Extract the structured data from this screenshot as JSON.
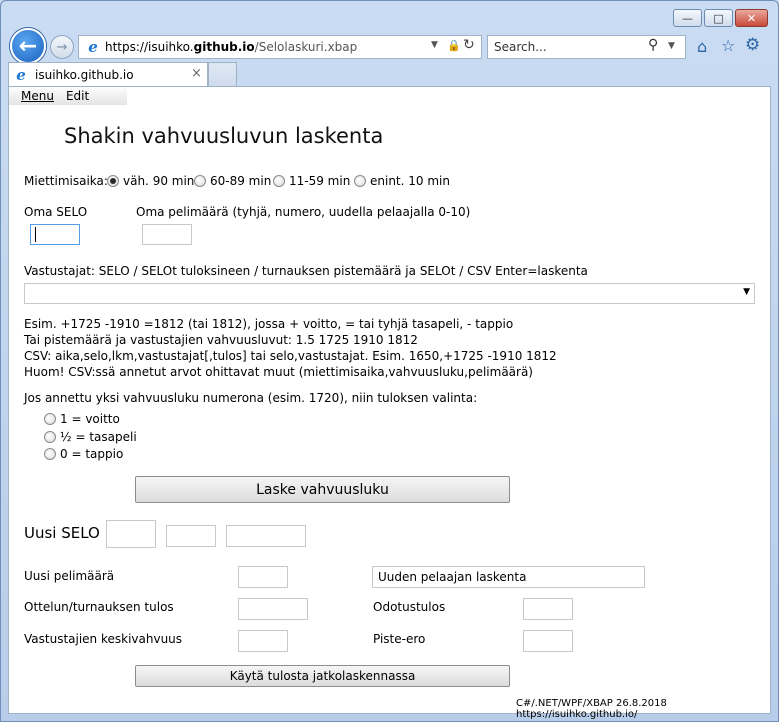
{
  "browser": {
    "url_prefix": "https://isuihko.",
    "url_domain": "github.io",
    "url_path": "/Selolaskuri.xbap",
    "search_placeholder": "Search...",
    "tab_title": "isuihko.github.io",
    "tab_close": "×"
  },
  "menubar": {
    "menu": "Menu",
    "edit": "Edit"
  },
  "page": {
    "title": "Shakin vahvuusluvun laskenta",
    "thinking_time": {
      "label": "Miettimisaika:",
      "options": [
        "väh. 90 min",
        "60-89 min",
        "11-59 min",
        "enint. 10 min"
      ],
      "selected": "väh. 90 min"
    },
    "own_selo_label": "Oma SELO",
    "own_games_label": "Oma pelimäärä (tyhjä, numero, uudella pelaajalla 0-10)",
    "opponents_label": "Vastustajat: SELO / SELOt tuloksineen / turnauksen pistemäärä ja SELOt / CSV  Enter=laskenta",
    "help": [
      "Esim. +1725 -1910 =1812 (tai 1812), jossa + voitto, = tai tyhjä tasapeli, - tappio",
      "Tai pistemäärä ja vastustajien vahvuusluvut: 1.5 1725 1910 1812",
      "CSV: aika,selo,lkm,vastustajat[,tulos] tai selo,vastustajat. Esim. 1650,+1725 -1910 1812",
      "Huom! CSV:ssä annetut arvot ohittavat muut (miettimisaika,vahvuusluku,pelimäärä)"
    ],
    "result_choice_label": "Jos annettu yksi vahvuusluku numerona (esim. 1720), niin tuloksen valinta:",
    "result_options": [
      "1 = voitto",
      "½ = tasapeli",
      "0 = tappio"
    ],
    "calc_button": "Laske vahvuusluku",
    "new_selo_label": "Uusi SELO",
    "new_games_label": "Uusi pelimäärä",
    "new_player_calc": "Uuden pelaajan laskenta",
    "match_result_label": "Ottelun/turnauksen tulos",
    "expected_label": "Odotustulos",
    "opp_avg_label": "Vastustajien keskivahvuus",
    "point_diff_label": "Piste-ero",
    "continue_button": "Käytä tulosta jatkolaskennassa",
    "footer": "C#/.NET/WPF/XBAP 26.8.2018 https://isuihko.github.io/"
  }
}
